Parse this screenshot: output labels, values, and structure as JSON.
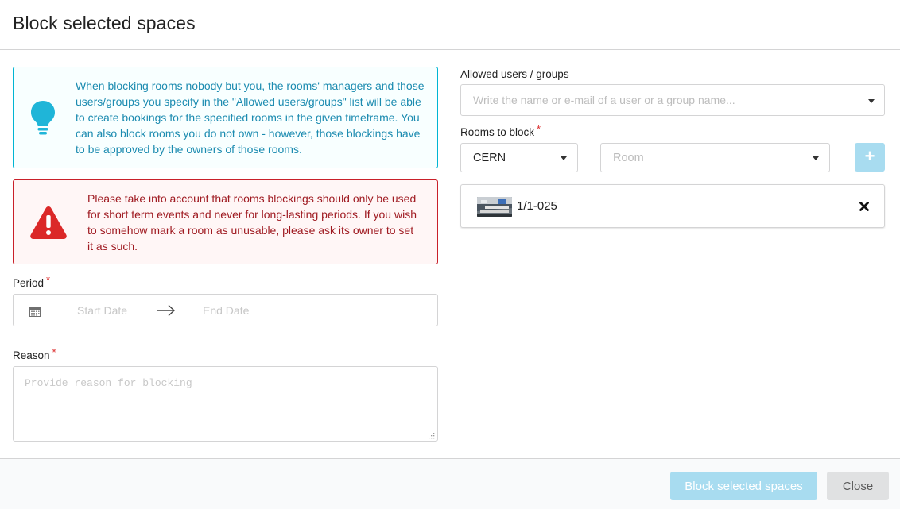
{
  "modal": {
    "title": "Block selected spaces"
  },
  "info_message": {
    "text": "When blocking rooms nobody but you, the rooms' managers and those users/groups you specify in the \"Allowed users/groups\" list will be able to create bookings for the specified rooms in the given timeframe. You can also block rooms you do not own - however, those blockings have to be approved by the owners of those rooms.",
    "icon": "lightbulb-icon",
    "color": "#1b8bb0"
  },
  "warning_message": {
    "text": "Please take into account that rooms blockings should only be used for short term events and never for long-lasting periods. If you wish to somehow mark a room as unusable, please ask its owner to set it as such.",
    "icon": "warning-triangle-icon",
    "color": "#9f1a21"
  },
  "period": {
    "label": "Period",
    "required_mark": "*",
    "start_placeholder": "Start Date",
    "end_placeholder": "End Date"
  },
  "reason": {
    "label": "Reason",
    "required_mark": "*",
    "placeholder": "Provide reason for blocking",
    "value": ""
  },
  "allowed": {
    "label": "Allowed users / groups",
    "placeholder": "Write the name or e-mail of a user or a group name..."
  },
  "rooms": {
    "label": "Rooms to block",
    "required_mark": "*",
    "location_value": "CERN",
    "room_placeholder": "Room",
    "add_icon": "plus-icon",
    "selected": [
      {
        "name": "1/1-025"
      }
    ]
  },
  "footer": {
    "submit_label": "Block selected spaces",
    "close_label": "Close"
  },
  "colors": {
    "accent_disabled": "#a8dcf0",
    "required": "#db2828"
  }
}
